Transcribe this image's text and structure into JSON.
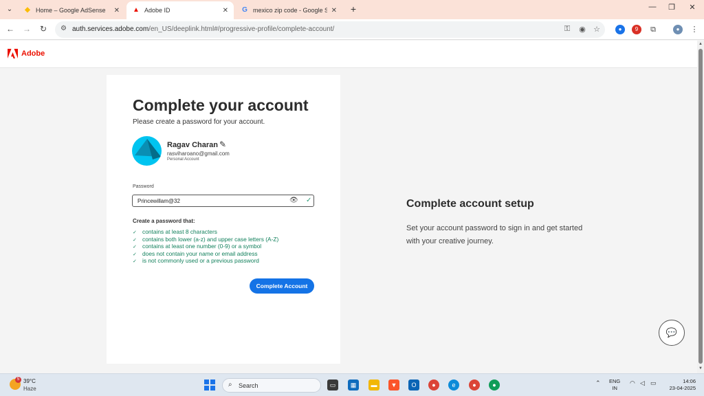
{
  "browser": {
    "tabs": [
      {
        "title": "Home – Google AdSense",
        "icon": "adsense-icon"
      },
      {
        "title": "Adobe ID",
        "icon": "adobe-icon"
      },
      {
        "title": "mexico zip code - Google Searc",
        "icon": "google-icon"
      }
    ],
    "url_host": "auth.services.adobe.com",
    "url_path": "/en_US/deeplink.html#/progressive-profile/complete-account/",
    "extension_badge": "9"
  },
  "header": {
    "brand": "Adobe"
  },
  "form": {
    "title": "Complete your account",
    "subtitle": "Please create a password for your account.",
    "user_name": "Ragav Charan",
    "user_email": "rasviharoano@gmail.com",
    "account_type": "Personal Account",
    "password_label": "Password",
    "password_value": "Princewillam@32",
    "requirements_heading": "Create a password that:",
    "requirements": [
      "contains at least 8 characters",
      "contains both lower (a-z) and upper case letters (A-Z)",
      "contains at least one number (0-9) or a symbol",
      "does not contain your name or email address",
      "is not commonly used or a previous password"
    ],
    "submit_label": "Complete Account"
  },
  "side": {
    "title": "Complete account setup",
    "text": "Set your account password to sign in and get started with your creative journey."
  },
  "taskbar": {
    "weather_badge": "5",
    "temperature": "39°C",
    "condition": "Haze",
    "search_label": "Search",
    "lang_line1": "ENG",
    "lang_line2": "IN",
    "time": "14:06",
    "date": "23-04-2025"
  },
  "colors": {
    "adobe_red": "#eb1000",
    "cta_blue": "#1473e6",
    "check_green": "#12805c"
  }
}
